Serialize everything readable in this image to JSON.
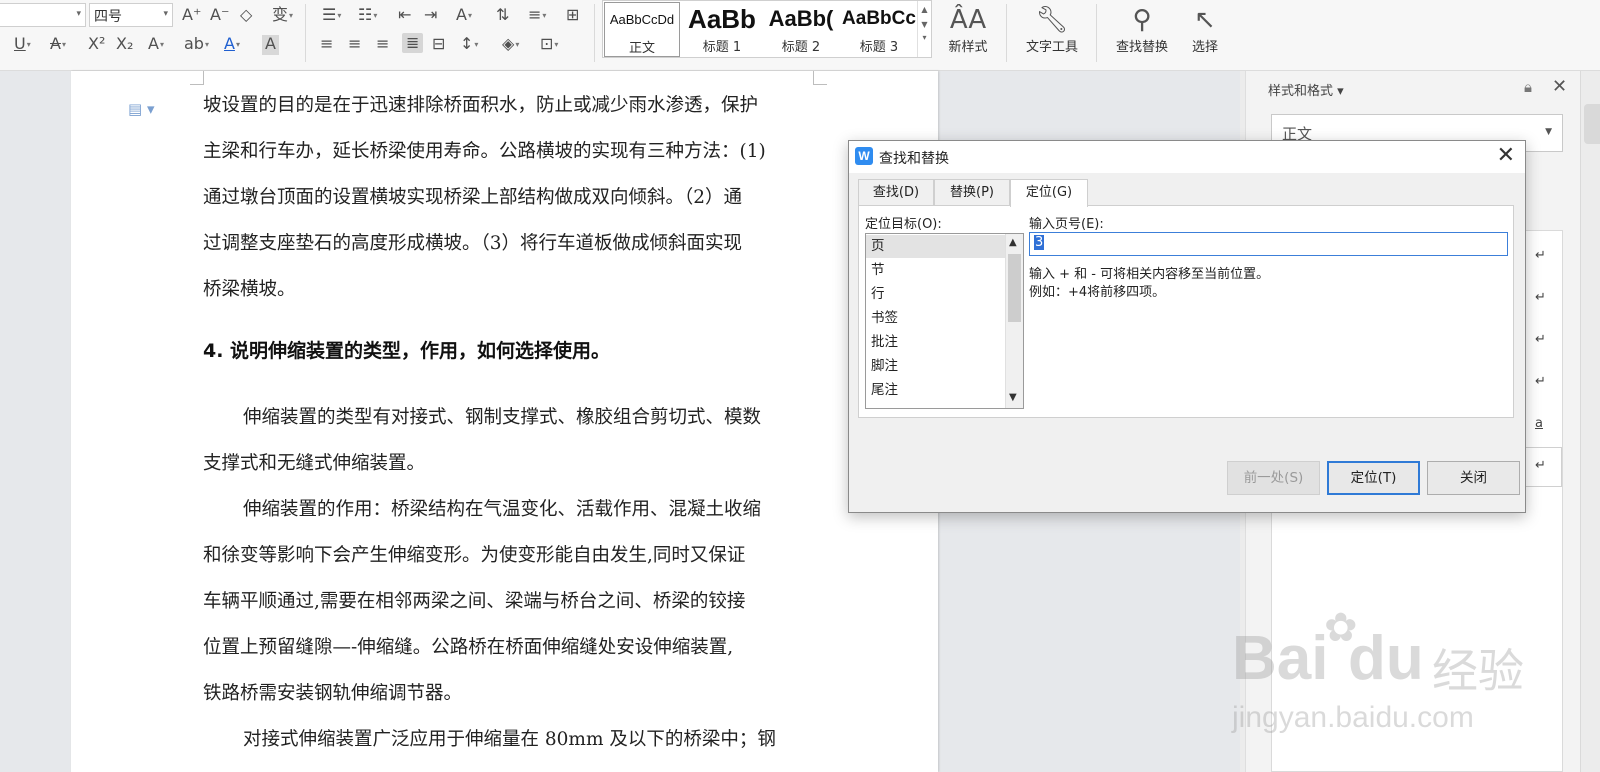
{
  "ribbon": {
    "font_size": "四号",
    "styles": [
      {
        "sample": "AaBbCcDd",
        "name": "正文"
      },
      {
        "sample": "AaBb",
        "name": "标题 1"
      },
      {
        "sample": "AaBb(",
        "name": "标题 2"
      },
      {
        "sample": "AaBbCc",
        "name": "标题 3"
      }
    ],
    "new_style": "新样式",
    "text_tools": "文字工具",
    "find_replace": "查找替换",
    "select": "选择"
  },
  "document": {
    "para1": [
      "坡设置的目的是在于迅速排除桥面积水，防止或减少雨水渗透，保护",
      "主梁和行车办，延长桥梁使用寿命。公路横坡的实现有三种方法：(1)",
      "通过墩台顶面的设置横坡实现桥梁上部结构做成双向倾斜。（2）通",
      "过调整支座垫石的高度形成横坡。（3）将行车道板做成倾斜面实现",
      "桥梁横坡。"
    ],
    "heading": "4. 说明伸缩装置的类型，作用，如何选择使用。",
    "para2": [
      "伸缩装置的类型有对接式、钢制支撑式、橡胶组合剪切式、模数",
      "支撑式和无缝式伸缩装置。"
    ],
    "para3": [
      "伸缩装置的作用：桥梁结构在气温变化、活载作用、混凝土收缩",
      "和徐变等影响下会产生伸缩变形。为使变形能自由发生,同时又保证",
      "车辆平顺通过,需要在相邻两梁之间、梁端与桥台之间、桥梁的铰接",
      "位置上预留缝隙—-伸缩缝。公路桥在桥面伸缩缝处安设伸缩装置,",
      "铁路桥需安装钢轨伸缩调节器。"
    ],
    "para4": [
      "对接式伸缩装置广泛应用于伸缩量在 80mm 及以下的桥梁中；钢"
    ]
  },
  "styles_panel": {
    "title": "样式和格式",
    "current_style": "正文",
    "marks": [
      "↵",
      "↵",
      "↵",
      "↵",
      "a",
      "↵"
    ]
  },
  "dialog": {
    "title": "查找和替换",
    "tabs": [
      "查找(D)",
      "替换(P)",
      "定位(G)"
    ],
    "target_label": "定位目标(O):",
    "targets": [
      "页",
      "节",
      "行",
      "书签",
      "批注",
      "脚注",
      "尾注"
    ],
    "page_label": "输入页号(E):",
    "page_value": "3",
    "hint1": "输入 + 和 - 可将相关内容移至当前位置。",
    "hint2": "例如：+4将前移四项。",
    "btn_prev": "前一处(S)",
    "btn_goto": "定位(T)",
    "btn_close": "关闭"
  },
  "watermark": {
    "brand": "Bai",
    "brand_mid": "du",
    "brand_cn": "经验",
    "url": "jingyan.baidu.com"
  }
}
